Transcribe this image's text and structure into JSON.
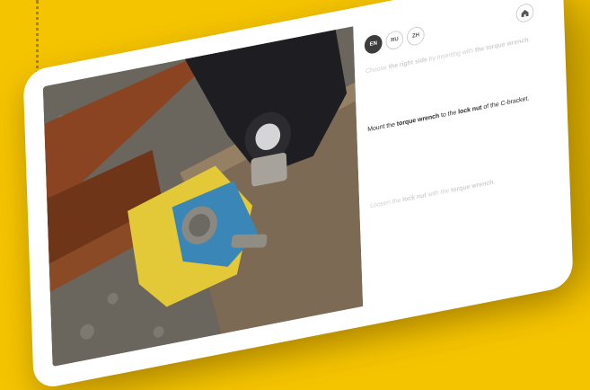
{
  "colors": {
    "background": "#f5c400",
    "rail": "#7a3d1c",
    "clamp_yellow": "#e3c838",
    "clamp_blue": "#3a86b6",
    "glove": "#1d1d22"
  },
  "languages": [
    {
      "code": "EN",
      "active": true
    },
    {
      "code": "RU",
      "active": false
    },
    {
      "code": "ZH",
      "active": false
    }
  ],
  "home_icon": "home-icon",
  "steps": [
    {
      "before": "Choose ",
      "strong1": "the right side",
      "middle": " by inserting with ",
      "strong2": "the torque wrench",
      "after": ".",
      "state": "previous"
    },
    {
      "before": "Mount the ",
      "strong1": "torque wrench",
      "middle": " to the ",
      "strong2": "lock nut",
      "after": " of the C-bracket.",
      "state": "current"
    },
    {
      "before": "Loosen the ",
      "strong1": "lock nut",
      "middle": " with the ",
      "strong2": "torque wrench",
      "after": ".",
      "state": "next"
    }
  ]
}
